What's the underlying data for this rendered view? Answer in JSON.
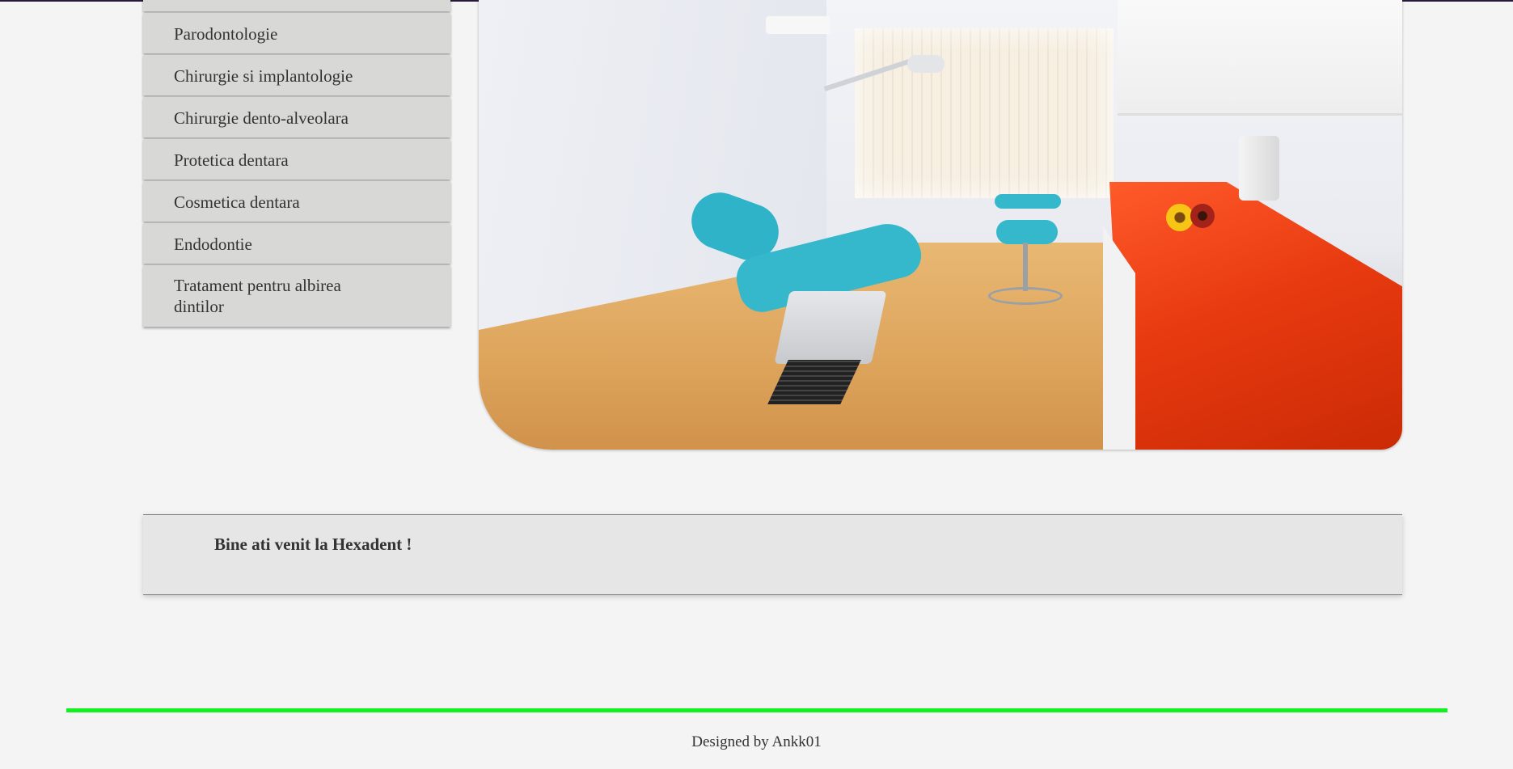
{
  "menu": {
    "items": [
      {
        "label": "Parodontologie"
      },
      {
        "label": "Chirurgie si implantologie"
      },
      {
        "label": "Chirurgie dento-alveolara"
      },
      {
        "label": "Protetica dentara"
      },
      {
        "label": "Cosmetica dentara"
      },
      {
        "label": "Endodontie"
      },
      {
        "label": "Tratament pentru albirea dintilor"
      }
    ]
  },
  "welcome": {
    "title": "Bine ati venit la Hexadent !"
  },
  "footer": {
    "text": "Designed by Ankk01"
  },
  "colors": {
    "divider": "#10f21e",
    "menu_bg": "#d8d9d6",
    "page_bg": "#f4f4f4"
  }
}
